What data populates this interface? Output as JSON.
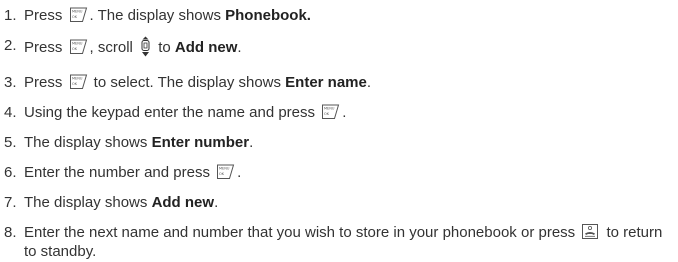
{
  "steps": [
    {
      "num": "1.",
      "parts": [
        {
          "t": "Press "
        },
        {
          "icon": "menu-ok-key"
        },
        {
          "t": ". The display shows "
        },
        {
          "b": "Phonebook."
        }
      ]
    },
    {
      "num": "2.",
      "parts": [
        {
          "t": "Press "
        },
        {
          "icon": "menu-ok-key"
        },
        {
          "t": ", scroll "
        },
        {
          "icon": "scroll-key"
        },
        {
          "t": " to "
        },
        {
          "b": "Add new"
        },
        {
          "t": "."
        }
      ]
    },
    {
      "num": "3.",
      "parts": [
        {
          "t": "Press "
        },
        {
          "icon": "menu-ok-key"
        },
        {
          "t": " to select. The display shows "
        },
        {
          "b": "Enter name"
        },
        {
          "t": "."
        }
      ]
    },
    {
      "num": "4.",
      "parts": [
        {
          "t": "Using the keypad enter the name and press "
        },
        {
          "icon": "menu-ok-key"
        },
        {
          "t": "."
        }
      ]
    },
    {
      "num": "5.",
      "parts": [
        {
          "t": "The display shows "
        },
        {
          "b": "Enter number"
        },
        {
          "t": "."
        }
      ]
    },
    {
      "num": "6.",
      "parts": [
        {
          "t": "Enter the number and press "
        },
        {
          "icon": "menu-ok-key"
        },
        {
          "t": "."
        }
      ]
    },
    {
      "num": "7.",
      "parts": [
        {
          "t": "The display shows "
        },
        {
          "b": "Add new"
        },
        {
          "t": "."
        }
      ]
    },
    {
      "num": "8.",
      "parts": [
        {
          "t": "Enter the next name and number that you wish to store in your phonebook or press "
        },
        {
          "icon": "end-key"
        },
        {
          "t": " to return to standby."
        }
      ]
    }
  ],
  "icons": {
    "menu_ok_key": {
      "top_label": "MENU",
      "bottom_label": "OK"
    }
  }
}
